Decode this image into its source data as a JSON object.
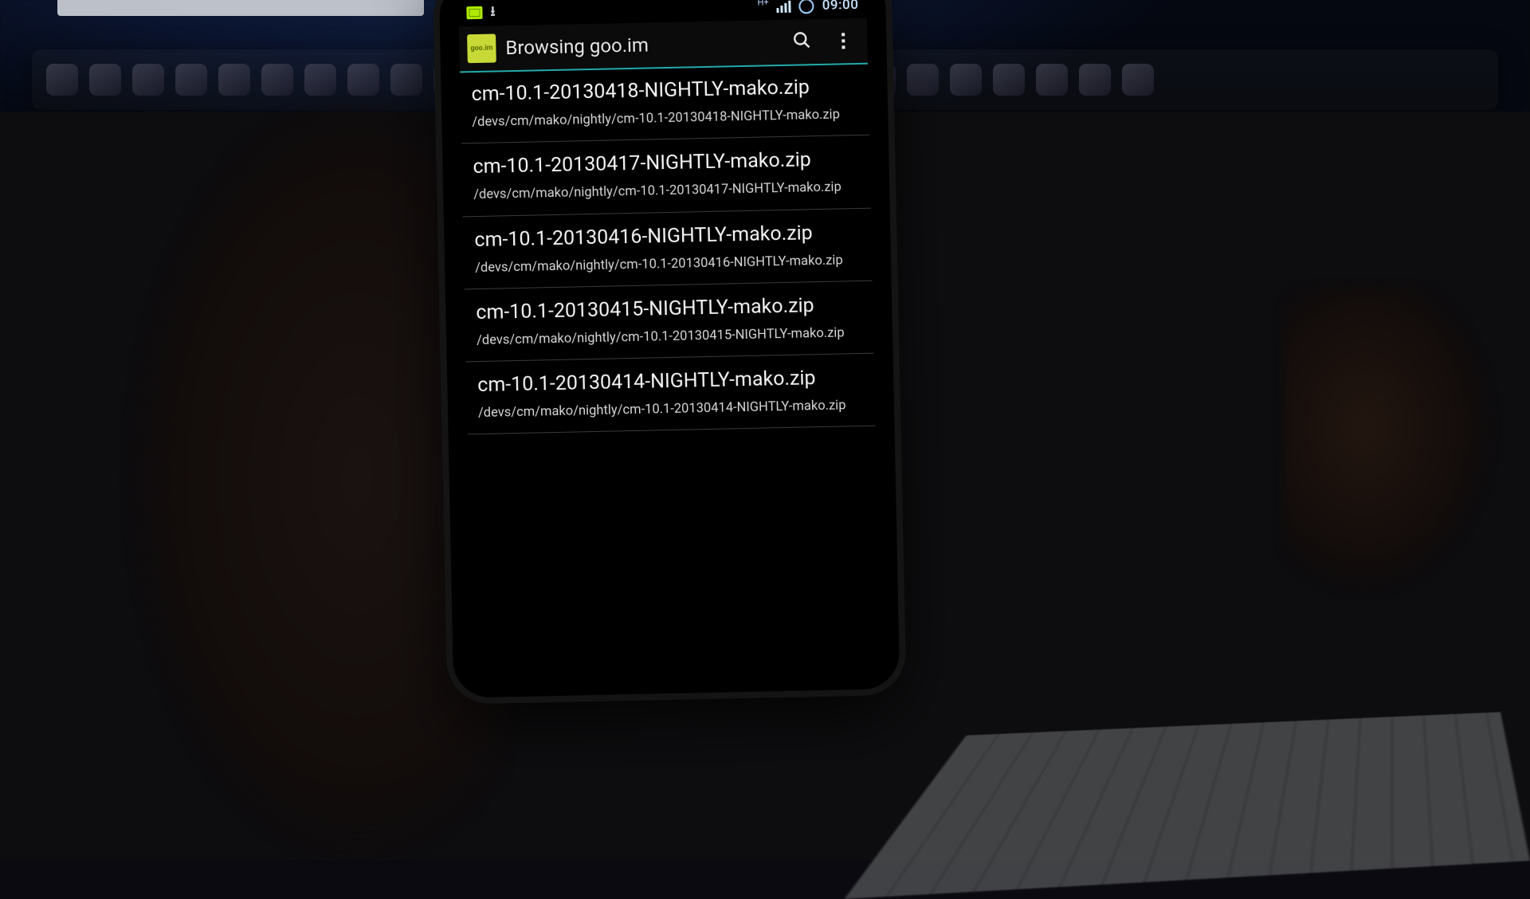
{
  "statusbar": {
    "network_label": "H+",
    "clock": "09:00"
  },
  "actionbar": {
    "app_icon_text": "goo.im",
    "title": "Browsing goo.im"
  },
  "files": [
    {
      "name": "cm-10.1-20130418-NIGHTLY-mako.zip",
      "path": "/devs/cm/mako/nightly/cm-10.1-20130418-NIGHTLY-mako.zip"
    },
    {
      "name": "cm-10.1-20130417-NIGHTLY-mako.zip",
      "path": "/devs/cm/mako/nightly/cm-10.1-20130417-NIGHTLY-mako.zip"
    },
    {
      "name": "cm-10.1-20130416-NIGHTLY-mako.zip",
      "path": "/devs/cm/mako/nightly/cm-10.1-20130416-NIGHTLY-mako.zip"
    },
    {
      "name": "cm-10.1-20130415-NIGHTLY-mako.zip",
      "path": "/devs/cm/mako/nightly/cm-10.1-20130415-NIGHTLY-mako.zip"
    },
    {
      "name": "cm-10.1-20130414-NIGHTLY-mako.zip",
      "path": "/devs/cm/mako/nightly/cm-10.1-20130414-NIGHTLY-mako.zip"
    }
  ]
}
